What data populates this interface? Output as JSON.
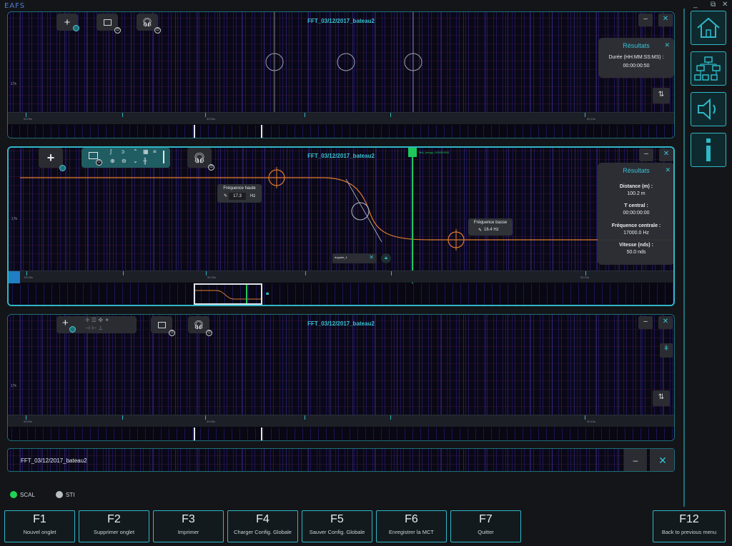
{
  "app": {
    "logo": "EAFS",
    "window_controls": [
      "_",
      "⧉",
      "✕"
    ]
  },
  "panels": [
    {
      "title": "FFT_03/12/2017_bateau2",
      "axis_label": "17k",
      "time_labels": [
        "00:00s",
        "00:05s",
        "00:10s"
      ],
      "results": {
        "title": "Résultats",
        "close": "✕",
        "lines": [
          "Durée (HH:MM:SS:MS) :",
          "00:00:00:50"
        ]
      }
    },
    {
      "title": "FFT_03/12/2017_bateau2",
      "axis_label": "17k",
      "time_labels": [
        "00:00s",
        "00:05s",
        "00:10s"
      ],
      "marker_label": "Mrk_bongo_000000000",
      "tip_high": {
        "label": "Fréquence haute",
        "value": "17.3",
        "unit": "Hz"
      },
      "tip_low": {
        "label": "Fréquence basse",
        "value": "16.4 Hz"
      },
      "search_value": "doppler_1",
      "results": {
        "title": "Résultats",
        "close": "✕",
        "items": [
          {
            "label": "Distance (m) :",
            "value": "100.2 m"
          },
          {
            "label": "T central :",
            "value": "00:00:00:00"
          },
          {
            "label": "Fréquence centrale :",
            "value": "17000.0 Hz"
          },
          {
            "label": "Vitesse (nds) :",
            "value": "50.0 nds"
          }
        ]
      }
    },
    {
      "title": "FFT_03/12/2017_bateau2",
      "axis_label": "17k",
      "time_labels": [
        "00:00s",
        "00:05s",
        "00:10s"
      ]
    }
  ],
  "collapsed_tab": {
    "title": "FFT_03/12/2017_bateau2"
  },
  "status": {
    "scal": "SCAL",
    "sti": "STI",
    "scal_color": "#1ed454",
    "sti_color": "#b9bec2"
  },
  "sidebar": {
    "icons": [
      "home-icon",
      "network-icon",
      "speaker-icon",
      "info-icon"
    ]
  },
  "fkeys": [
    {
      "key": "F1",
      "label": "Nouvel onglet"
    },
    {
      "key": "F2",
      "label": "Supprimer onglet"
    },
    {
      "key": "F3",
      "label": "Imprimer"
    },
    {
      "key": "F4",
      "label": "Charger Config. Globale"
    },
    {
      "key": "F5",
      "label": "Sauver Config. Globale"
    },
    {
      "key": "F6",
      "label": "Enregistrer la MCT"
    },
    {
      "key": "F7",
      "label": "Quitter"
    },
    {
      "key": "F12",
      "label": "Back to previous menu"
    }
  ],
  "colors": {
    "accent": "#2fb7c7",
    "curve": "#e07b2e",
    "marker": "#1ec85a",
    "spectrum": "#2a1e8c"
  }
}
